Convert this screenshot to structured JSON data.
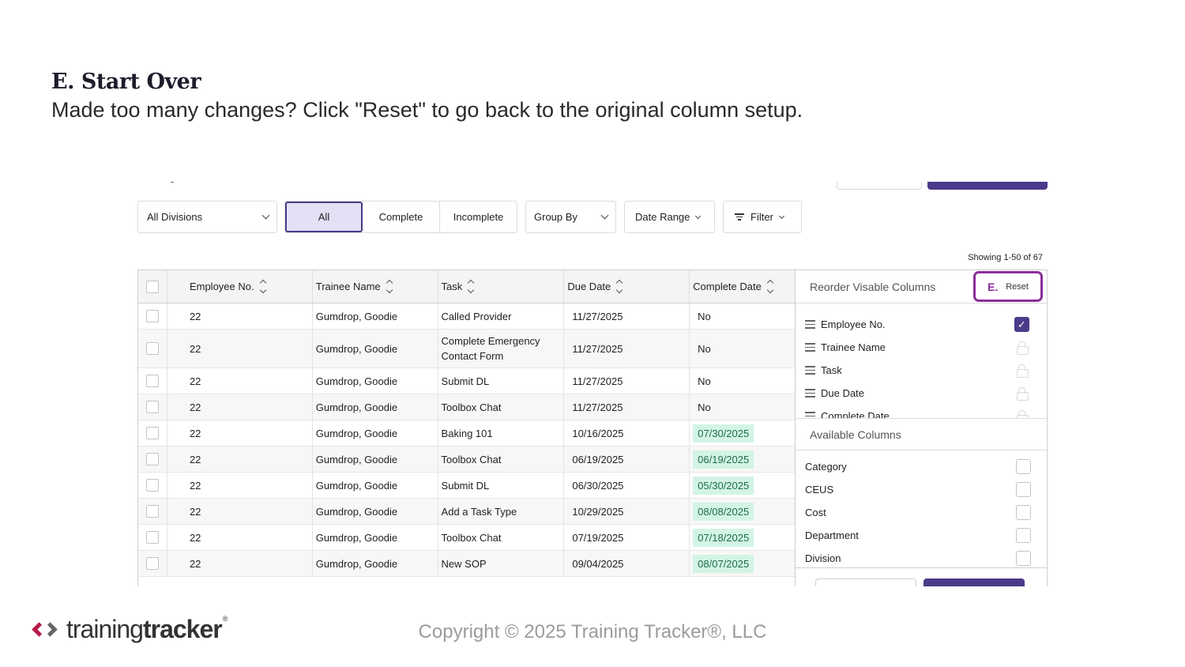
{
  "slide": {
    "heading": "E. Start Over",
    "subtitle": "Made too many changes? Click \"Reset\" to go back to the original column setup."
  },
  "toolbar": {
    "divisions_label": "All Divisions",
    "segments": [
      "All",
      "Complete",
      "Incomplete"
    ],
    "active_segment": "All",
    "group_by_label": "Group By",
    "date_range_label": "Date Range",
    "filter_label": "Filter"
  },
  "showing_text": "Showing 1-50 of 67",
  "table": {
    "headers": {
      "employee_no": "Employee No.",
      "trainee_name": "Trainee Name",
      "task": "Task",
      "due_date": "Due Date",
      "complete_date": "Complete Date"
    },
    "rows": [
      {
        "emp": "22",
        "name": "Gumdrop, Goodie",
        "task": "Called Provider",
        "due": "11/27/2025",
        "complete": "No",
        "complete_done": false
      },
      {
        "emp": "22",
        "name": "Gumdrop, Goodie",
        "task": "Complete Emergency Contact Form",
        "due": "11/27/2025",
        "complete": "No",
        "complete_done": false
      },
      {
        "emp": "22",
        "name": "Gumdrop, Goodie",
        "task": "Submit DL",
        "due": "11/27/2025",
        "complete": "No",
        "complete_done": false
      },
      {
        "emp": "22",
        "name": "Gumdrop, Goodie",
        "task": "Toolbox Chat",
        "due": "11/27/2025",
        "complete": "No",
        "complete_done": false
      },
      {
        "emp": "22",
        "name": "Gumdrop, Goodie",
        "task": "Baking 101",
        "due": "10/16/2025",
        "complete": "07/30/2025",
        "complete_done": true
      },
      {
        "emp": "22",
        "name": "Gumdrop, Goodie",
        "task": "Toolbox Chat",
        "due": "06/19/2025",
        "complete": "06/19/2025",
        "complete_done": true
      },
      {
        "emp": "22",
        "name": "Gumdrop, Goodie",
        "task": "Submit DL",
        "due": "06/30/2025",
        "complete": "05/30/2025",
        "complete_done": true
      },
      {
        "emp": "22",
        "name": "Gumdrop, Goodie",
        "task": "Add a Task Type",
        "due": "10/29/2025",
        "complete": "08/08/2025",
        "complete_done": true
      },
      {
        "emp": "22",
        "name": "Gumdrop, Goodie",
        "task": "Toolbox Chat",
        "due": "07/19/2025",
        "complete": "07/18/2025",
        "complete_done": true
      },
      {
        "emp": "22",
        "name": "Gumdrop, Goodie",
        "task": "New SOP",
        "due": "09/04/2025",
        "complete": "08/07/2025",
        "complete_done": true
      }
    ]
  },
  "panel": {
    "title": "Reorder Visable Columns",
    "reset_marker": "E.",
    "reset_label": "Reset",
    "visible_columns": [
      {
        "label": "Employee No.",
        "state": "checked"
      },
      {
        "label": "Trainee Name",
        "state": "locked"
      },
      {
        "label": "Task",
        "state": "locked"
      },
      {
        "label": "Due Date",
        "state": "locked"
      },
      {
        "label": "Complete Date",
        "state": "locked"
      }
    ],
    "available_title": "Available Columns",
    "available_columns": [
      "Category",
      "CEUS",
      "Cost",
      "Department",
      "Division"
    ]
  },
  "footer": {
    "logo_light": "training",
    "logo_bold": "tracker",
    "logo_reg": "®",
    "copyright": "Copyright © 2025 Training Tracker®, LLC"
  },
  "colors": {
    "accent_purple": "#4b3a8a",
    "reset_highlight": "#8b2e9a",
    "complete_badge_bg": "#d3f4e5",
    "logo_red": "#b8194a"
  }
}
